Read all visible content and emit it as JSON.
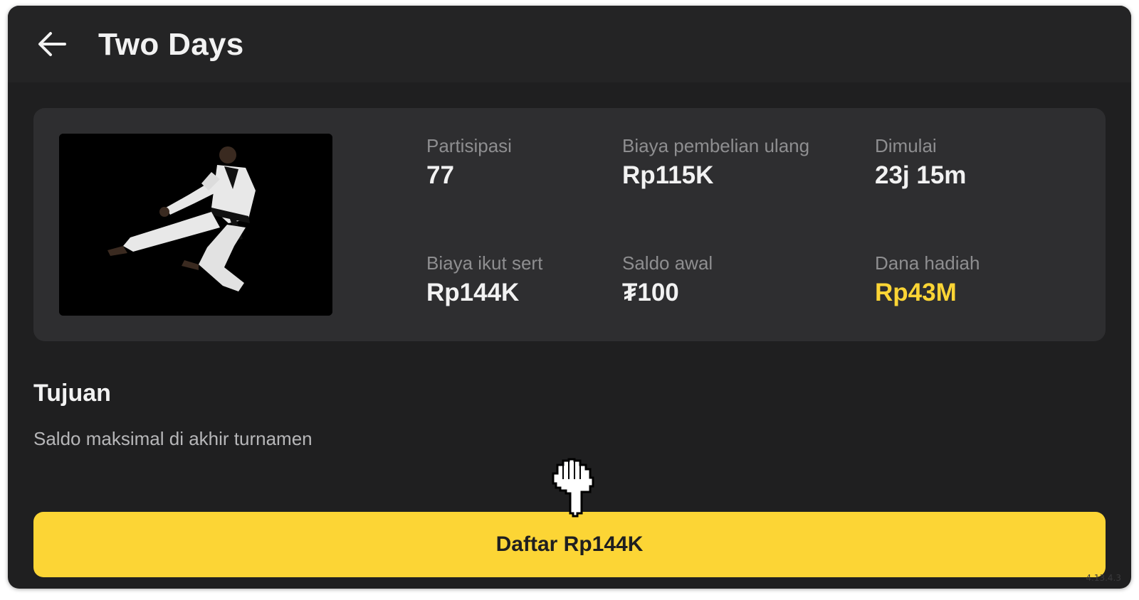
{
  "header": {
    "title": "Two Days",
    "back_icon": "arrow-left-icon"
  },
  "tournament": {
    "image_icon": "taekwondo-kick-photo",
    "stats": [
      {
        "label": "Partisipasi",
        "value": "77"
      },
      {
        "label": "Biaya pembelian ulang",
        "value": "Rp115K"
      },
      {
        "label": "Dimulai",
        "value": "23j 15m"
      },
      {
        "label": "Biaya ikut sert",
        "value": "Rp144K"
      },
      {
        "label": "Saldo awal",
        "value": "₮100"
      },
      {
        "label": "Dana hadiah",
        "value": "Rp43M"
      }
    ]
  },
  "goal": {
    "title": "Tujuan",
    "description": "Saldo maksimal di akhir turnamen"
  },
  "register_button": {
    "label": "Daftar Rp144K"
  },
  "version": "4.13.4.3",
  "colors": {
    "background": "#1f1f20",
    "card": "#2e2e30",
    "accent": "#fcd535"
  }
}
